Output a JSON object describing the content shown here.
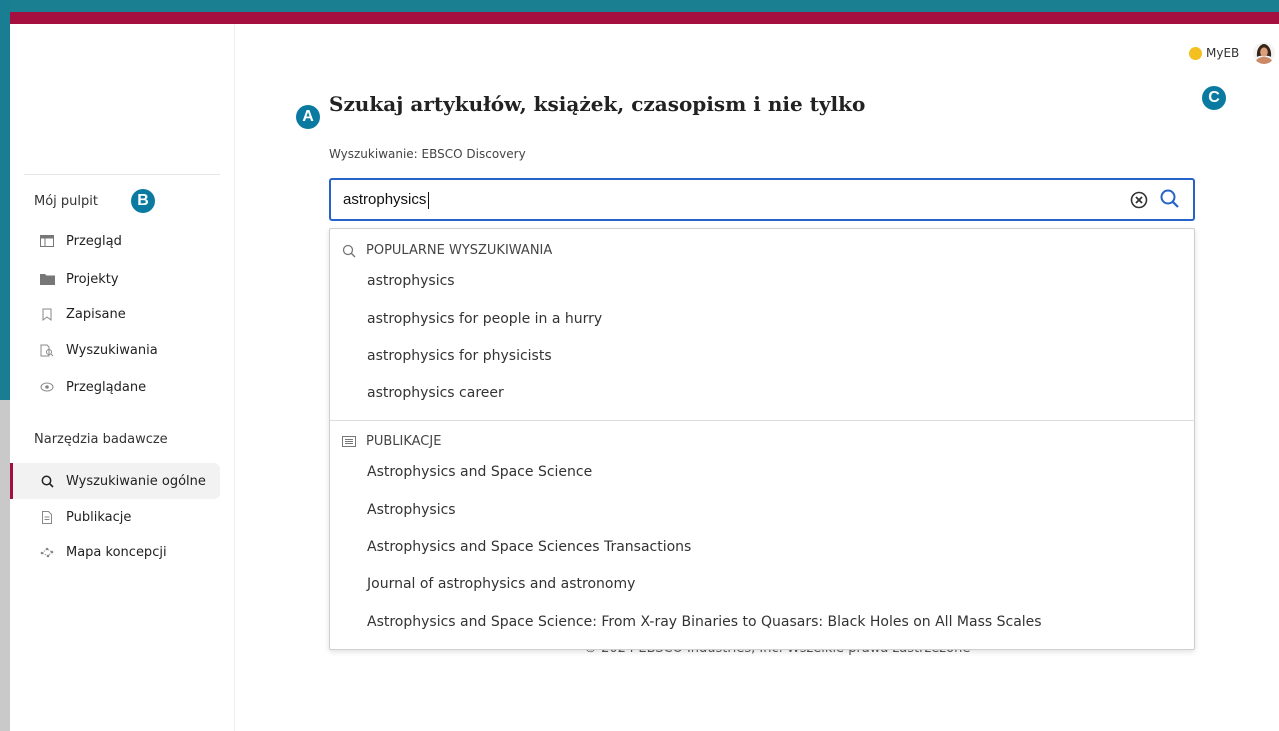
{
  "sidebar": {
    "section1_label": "Mój pulpit",
    "section1_items": [
      {
        "label": "Przegląd",
        "icon": "layout-icon"
      },
      {
        "label": "Projekty",
        "icon": "folder-icon"
      },
      {
        "label": "Zapisane",
        "icon": "bookmark-icon"
      },
      {
        "label": "Wyszukiwania",
        "icon": "search-history-icon"
      },
      {
        "label": "Przeglądane",
        "icon": "eye-icon"
      }
    ],
    "section2_label": "Narzędzia badawcze",
    "section2_items": [
      {
        "label": "Wyszukiwanie ogólne",
        "icon": "search-icon",
        "active": true
      },
      {
        "label": "Publikacje",
        "icon": "document-icon"
      },
      {
        "label": "Mapa koncepcji",
        "icon": "concept-map-icon"
      }
    ]
  },
  "markers": {
    "a": "A",
    "b": "B",
    "c": "C"
  },
  "header": {
    "myeb_label": "MyEB"
  },
  "main": {
    "title": "Szukaj artykułów, książek, czasopism i nie tylko",
    "scope_label": "Wyszukiwanie:  EBSCO Discovery",
    "search_value": "astrophysics",
    "footer": "© 2024 EBSCO Industries, Inc. Wszelkie prawa zastrzeżone"
  },
  "dropdown": {
    "popular_header": "POPULARNE WYSZUKIWANIA",
    "popular_items": [
      "astrophysics",
      "astrophysics for people in a hurry",
      "astrophysics for physicists",
      "astrophysics career"
    ],
    "publications_header": "PUBLIKACJE",
    "publication_items": [
      "Astrophysics and Space Science",
      "Astrophysics",
      "Astrophysics and Space Sciences Transactions",
      "Journal of astrophysics and astronomy",
      "Astrophysics and Space Science: From X-ray Binaries to Quasars: Black Holes on All Mass Scales"
    ]
  },
  "colors": {
    "accent": "#a50f3f",
    "focus": "#2563c9",
    "marker": "#0b7aa0",
    "myeb_dot": "#f3c020"
  }
}
